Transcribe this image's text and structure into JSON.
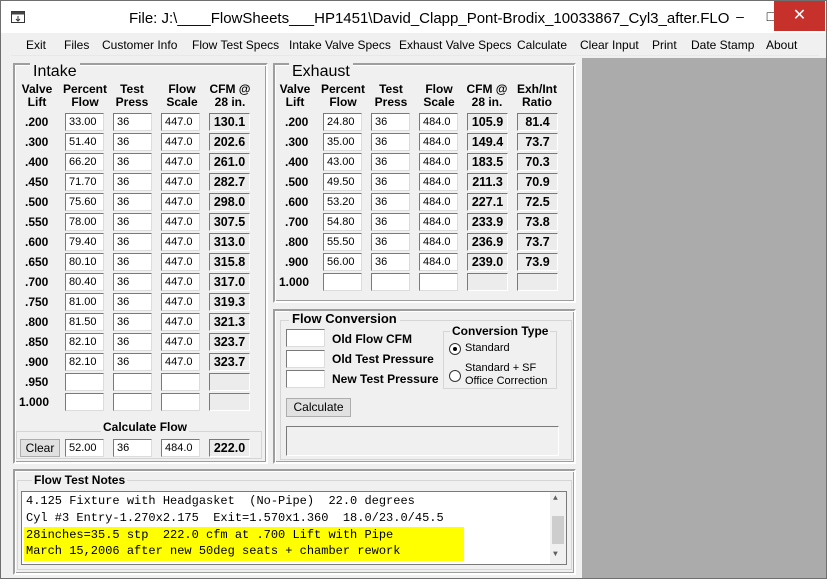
{
  "window": {
    "title": "File:  J:\\____FlowSheets___HP1451\\David_Clapp_Pont-Brodix_10033867_Cyl3_after.FLO",
    "app_icon": "app-icon",
    "min_icon": "minimize-icon",
    "max_icon": "maximize-icon",
    "close_icon": "close-icon",
    "min_glyph": "–",
    "max_glyph": "□",
    "close_glyph": "✕"
  },
  "menu": [
    "Exit",
    "Files",
    "Customer Info",
    "Flow Test Specs",
    "Intake Valve Specs",
    "Exhaust Valve Specs",
    "Calculate",
    "Clear Input",
    "Print",
    "Date Stamp",
    "About"
  ],
  "intake": {
    "title": "Intake",
    "headers": {
      "lift": "Valve\nLift",
      "pct": "Percent\nFlow",
      "press": "Test\nPress",
      "scale": "Flow\nScale",
      "cfm": "CFM @\n28 in."
    },
    "rows": [
      {
        "lift": ".200",
        "pct": "33.00",
        "press": "36",
        "scale": "447.0",
        "cfm": "130.1"
      },
      {
        "lift": ".300",
        "pct": "51.40",
        "press": "36",
        "scale": "447.0",
        "cfm": "202.6"
      },
      {
        "lift": ".400",
        "pct": "66.20",
        "press": "36",
        "scale": "447.0",
        "cfm": "261.0"
      },
      {
        "lift": ".450",
        "pct": "71.70",
        "press": "36",
        "scale": "447.0",
        "cfm": "282.7"
      },
      {
        "lift": ".500",
        "pct": "75.60",
        "press": "36",
        "scale": "447.0",
        "cfm": "298.0"
      },
      {
        "lift": ".550",
        "pct": "78.00",
        "press": "36",
        "scale": "447.0",
        "cfm": "307.5"
      },
      {
        "lift": ".600",
        "pct": "79.40",
        "press": "36",
        "scale": "447.0",
        "cfm": "313.0"
      },
      {
        "lift": ".650",
        "pct": "80.10",
        "press": "36",
        "scale": "447.0",
        "cfm": "315.8"
      },
      {
        "lift": ".700",
        "pct": "80.40",
        "press": "36",
        "scale": "447.0",
        "cfm": "317.0"
      },
      {
        "lift": ".750",
        "pct": "81.00",
        "press": "36",
        "scale": "447.0",
        "cfm": "319.3"
      },
      {
        "lift": ".800",
        "pct": "81.50",
        "press": "36",
        "scale": "447.0",
        "cfm": "321.3"
      },
      {
        "lift": ".850",
        "pct": "82.10",
        "press": "36",
        "scale": "447.0",
        "cfm": "323.7"
      },
      {
        "lift": ".900",
        "pct": "82.10",
        "press": "36",
        "scale": "447.0",
        "cfm": "323.7"
      },
      {
        "lift": ".950",
        "pct": "",
        "press": "",
        "scale": "",
        "cfm": ""
      },
      {
        "lift": "1.000",
        "pct": "",
        "press": "",
        "scale": "",
        "cfm": ""
      }
    ],
    "calc_flow": {
      "label": "Calculate Flow",
      "clear_label": "Clear",
      "pct": "52.00",
      "press": "36",
      "scale": "484.0",
      "cfm": "222.0"
    }
  },
  "exhaust": {
    "title": "Exhaust",
    "headers": {
      "lift": "Valve\nLift",
      "pct": "Percent\nFlow",
      "press": "Test\nPress",
      "scale": "Flow\nScale",
      "cfm": "CFM @\n28 in.",
      "ratio": "Exh/Int\nRatio"
    },
    "rows": [
      {
        "lift": ".200",
        "pct": "24.80",
        "press": "36",
        "scale": "484.0",
        "cfm": "105.9",
        "ratio": "81.4"
      },
      {
        "lift": ".300",
        "pct": "35.00",
        "press": "36",
        "scale": "484.0",
        "cfm": "149.4",
        "ratio": "73.7"
      },
      {
        "lift": ".400",
        "pct": "43.00",
        "press": "36",
        "scale": "484.0",
        "cfm": "183.5",
        "ratio": "70.3"
      },
      {
        "lift": ".500",
        "pct": "49.50",
        "press": "36",
        "scale": "484.0",
        "cfm": "211.3",
        "ratio": "70.9"
      },
      {
        "lift": ".600",
        "pct": "53.20",
        "press": "36",
        "scale": "484.0",
        "cfm": "227.1",
        "ratio": "72.5"
      },
      {
        "lift": ".700",
        "pct": "54.80",
        "press": "36",
        "scale": "484.0",
        "cfm": "233.9",
        "ratio": "73.8"
      },
      {
        "lift": ".800",
        "pct": "55.50",
        "press": "36",
        "scale": "484.0",
        "cfm": "236.9",
        "ratio": "73.7"
      },
      {
        "lift": ".900",
        "pct": "56.00",
        "press": "36",
        "scale": "484.0",
        "cfm": "239.0",
        "ratio": "73.9"
      },
      {
        "lift": "1.000",
        "pct": "",
        "press": "",
        "scale": "",
        "cfm": "",
        "ratio": ""
      }
    ]
  },
  "conversion": {
    "title": "Flow Conversion",
    "old_cfm_label": "Old Flow CFM",
    "old_press_label": "Old Test Pressure",
    "new_press_label": "New Test Pressure",
    "old_cfm": "",
    "old_press": "",
    "new_press": "",
    "type_title": "Conversion Type",
    "option_standard": "Standard",
    "option_sf_line1": "Standard + SF",
    "option_sf_line2": "Office Correction",
    "selected": "Standard",
    "calc_label": "Calculate",
    "result": ""
  },
  "notes": {
    "title": "Flow Test Notes",
    "lines": [
      "4.125 Fixture with Headgasket  (No-Pipe)  22.0 degrees",
      "Cyl #3 Entry-1.270x2.175  Exit=1.570x1.360  18.0/23.0/45.5",
      "28inches=35.5 stp  222.0 cfm at .700 Lift with Pipe",
      "March 15,2006 after new 50deg seats + chamber rework"
    ],
    "highlight_color": "#ffff00",
    "scroll_up_glyph": "▲",
    "scroll_down_glyph": "▼"
  }
}
